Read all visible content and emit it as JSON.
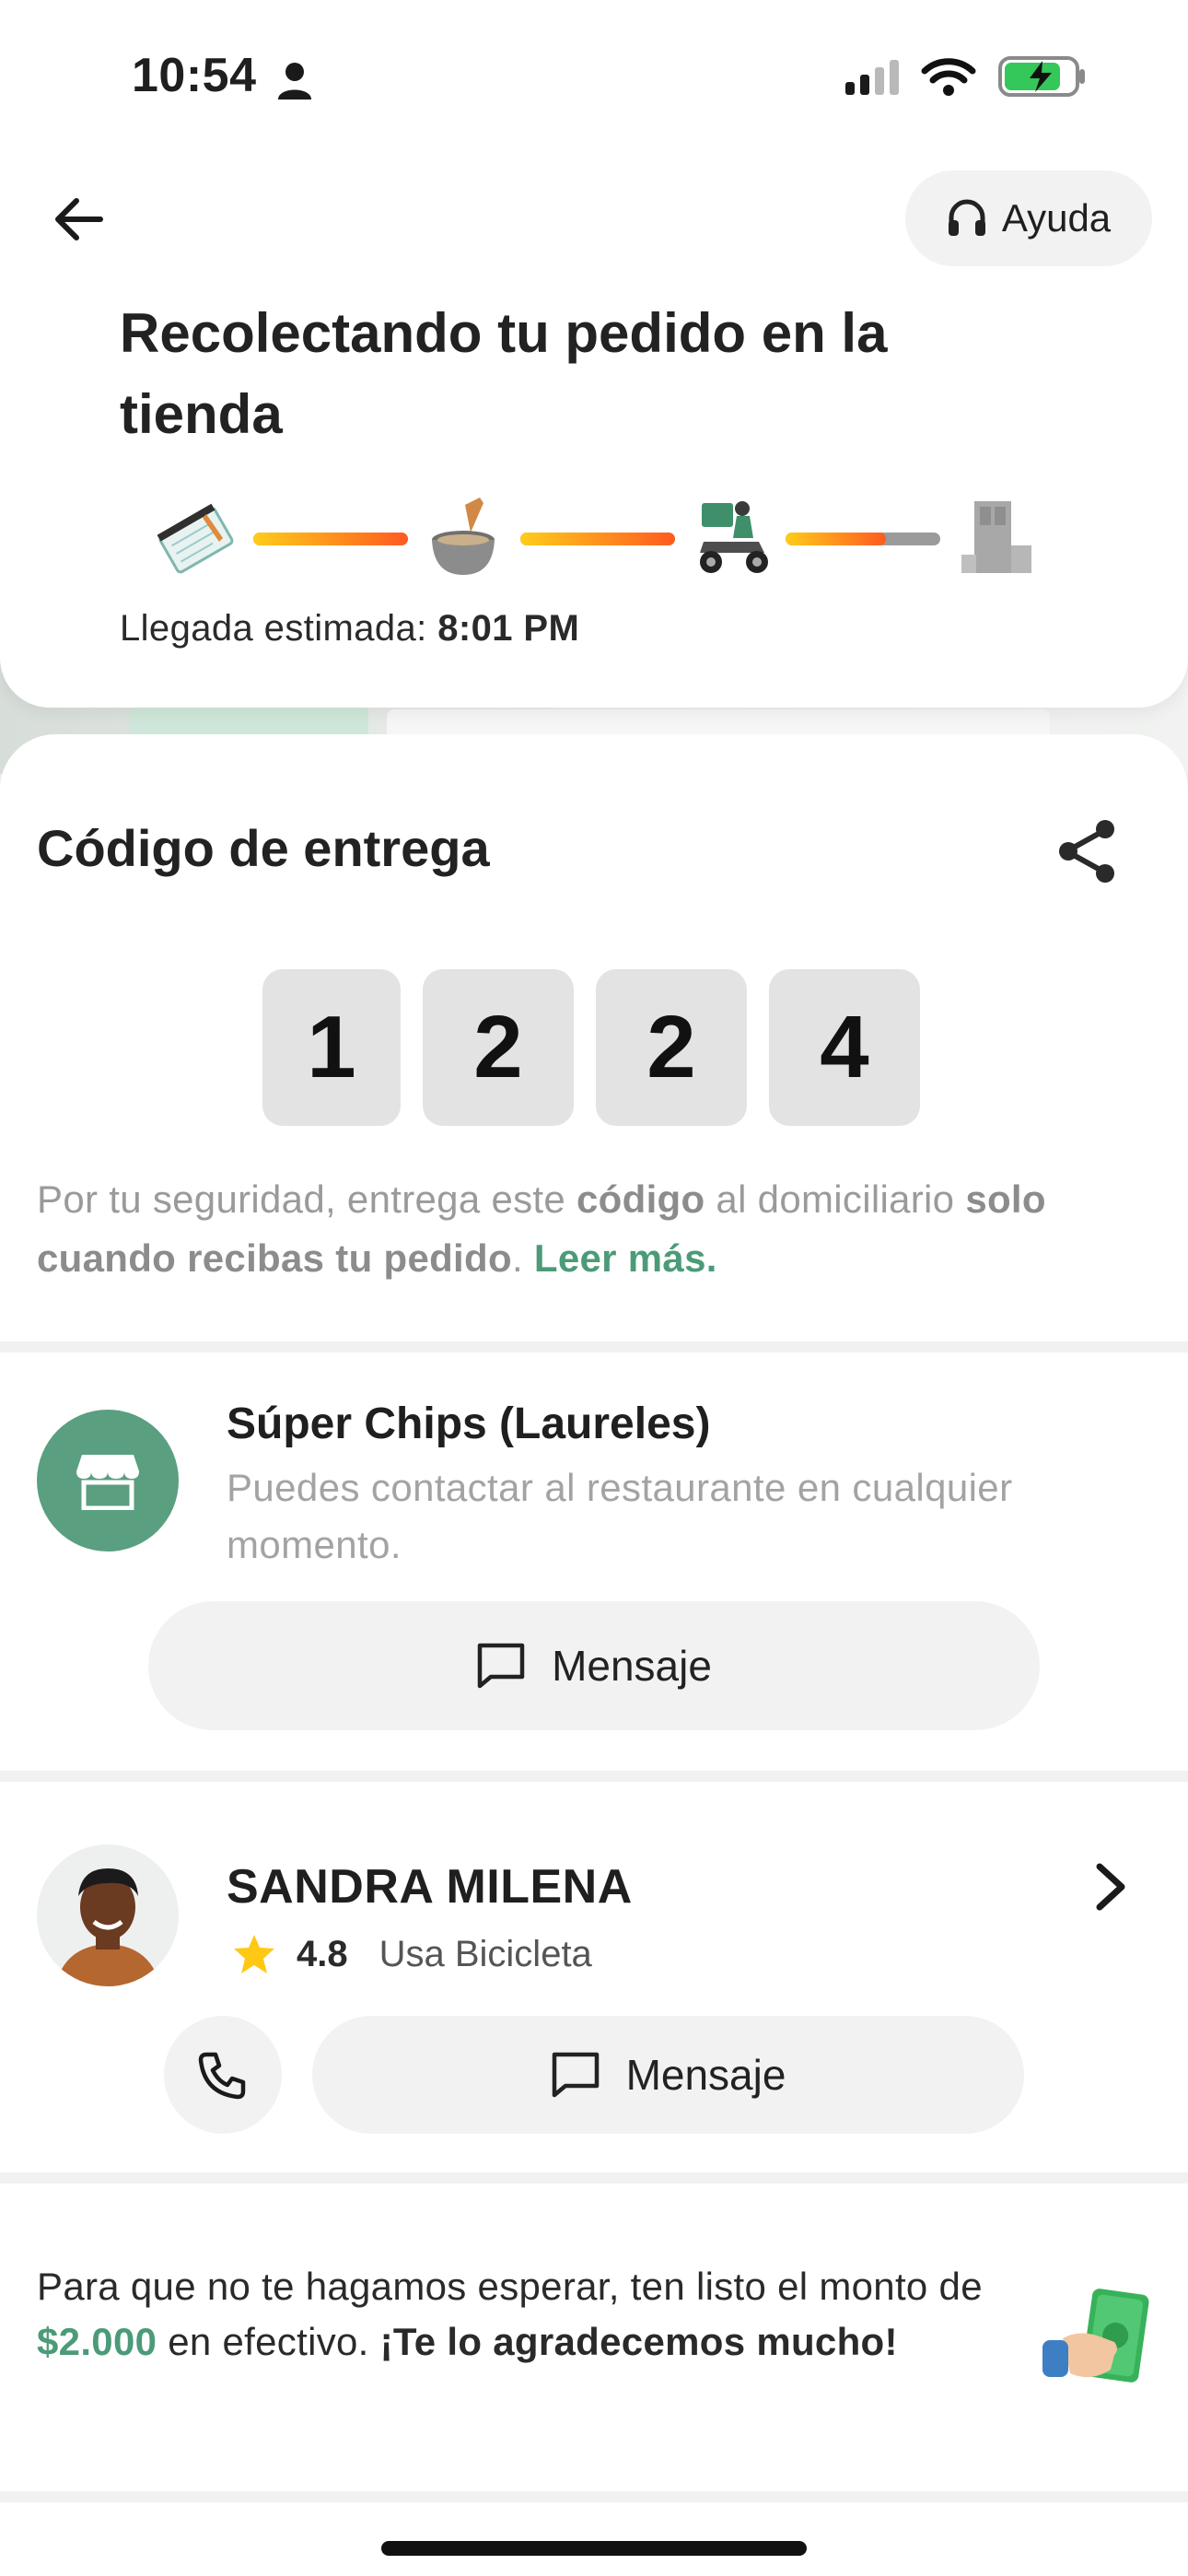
{
  "status_bar": {
    "time": "10:54"
  },
  "header": {
    "help_label": "Ayuda",
    "title": "Recolectando tu pedido en la tienda"
  },
  "progress": {
    "stages": [
      "order-notepad",
      "cooking-mortar",
      "delivery-motorbike",
      "arrived-building"
    ],
    "segments_fill": [
      1.0,
      1.0,
      0.65
    ],
    "eta_label": "Llegada estimada: ",
    "eta_time": "8:01 PM"
  },
  "delivery_code": {
    "title": "Código de entrega",
    "digits": [
      "1",
      "2",
      "2",
      "4"
    ],
    "note_part1": "Por tu seguridad, entrega este ",
    "note_bold1": "código",
    "note_part2": " al domiciliario ",
    "note_bold2": "solo cuando recibas tu pedido",
    "note_part3": ". ",
    "note_link": "Leer más."
  },
  "restaurant": {
    "name": "Súper Chips (Laureles)",
    "subtitle": "Puedes contactar al restaurante en cualquier momento.",
    "message_label": "Mensaje"
  },
  "courier": {
    "name": "SANDRA MILENA",
    "rating": "4.8",
    "vehicle": "Usa Bicicleta",
    "message_label": "Mensaje"
  },
  "cash": {
    "part1": "Para que no te hagamos esperar, ten listo el monto de ",
    "amount": "$2.000",
    "part2": " en efectivo. ",
    "thanks": "¡Te lo agradecemos mucho!"
  },
  "colors": {
    "accent_green": "#4c9b78",
    "store_green": "#5a9f80",
    "progress_start": "#ffcc1a",
    "progress_end": "#ff5a1f"
  }
}
